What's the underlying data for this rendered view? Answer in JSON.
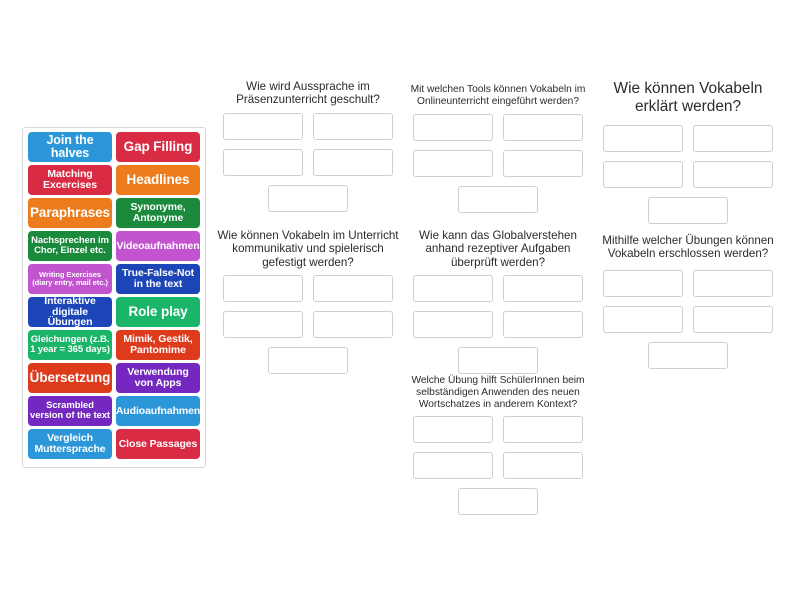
{
  "tile_bank": {
    "name": "answer-tiles",
    "tiles": [
      {
        "label": "Join the halves",
        "color": "#2b96d8",
        "size": "lg"
      },
      {
        "label": "Gap Filling",
        "color": "#d92b43",
        "size": "xl"
      },
      {
        "label": "Matching\nExcercises",
        "color": "#d92b43",
        "size": "md"
      },
      {
        "label": "Headlines",
        "color": "#ec7c1c",
        "size": "xl"
      },
      {
        "label": "Paraphrases",
        "color": "#ec7c1c",
        "size": "xl"
      },
      {
        "label": "Synonyme,\nAntonyme",
        "color": "#1c8a3c",
        "size": "md"
      },
      {
        "label": "Nachsprechen im\nChor, Einzel etc.",
        "color": "#1c8a3c",
        "size": "sm"
      },
      {
        "label": "Videoaufnahmen",
        "color": "#c254d0",
        "size": "md"
      },
      {
        "label": "Writing Exercises\n(diary entry, mail etc.)",
        "color": "#c254d0",
        "size": "xs"
      },
      {
        "label": "True-False-Not\nin the text",
        "color": "#1c46b8",
        "size": "md"
      },
      {
        "label": "Interaktive\ndigitale Übungen",
        "color": "#1c46b8",
        "size": "md"
      },
      {
        "label": "Role play",
        "color": "#1bb56a",
        "size": "xl"
      },
      {
        "label": "Gleichungen (z.B.\n1 year = 365 days)",
        "color": "#1bb56a",
        "size": "sm"
      },
      {
        "label": "Mimik, Gestik,\nPantomime",
        "color": "#dd3b1c",
        "size": "md"
      },
      {
        "label": "Übersetzung",
        "color": "#dd3b1c",
        "size": "xl"
      },
      {
        "label": "Verwendung\nvon Apps",
        "color": "#7428bf",
        "size": "md"
      },
      {
        "label": "Scrambled\nversion of the text",
        "color": "#7428bf",
        "size": "sm"
      },
      {
        "label": "Audioaufnahmen",
        "color": "#2b96d8",
        "size": "md"
      },
      {
        "label": "Vergleich\nMuttersprache",
        "color": "#2b96d8",
        "size": "md"
      },
      {
        "label": "Close Passages",
        "color": "#d92b43",
        "size": "md"
      }
    ]
  },
  "questions": [
    {
      "id": "q1",
      "title": "Wie wird Aussprache im Präsenzunterricht geschult?",
      "slot_count": 5
    },
    {
      "id": "q2",
      "title": "Mit welchen Tools können Vokabeln im Onlineunterricht eingeführt werden?",
      "slot_count": 5
    },
    {
      "id": "q3",
      "title": "Wie können Vokabeln erklärt werden?",
      "slot_count": 5
    },
    {
      "id": "q4",
      "title": "Wie können Vokabeln im Unterricht kommunikativ und spielerisch gefestigt werden?",
      "slot_count": 5
    },
    {
      "id": "q5",
      "title": "Wie kann das Globalverstehen anhand rezeptiver Aufgaben überprüft werden?",
      "slot_count": 5
    },
    {
      "id": "q6",
      "title": "Mithilfe welcher Übungen können Vokabeln erschlossen werden?",
      "slot_count": 5
    },
    {
      "id": "q7",
      "title": "Welche Übung hilft SchülerInnen beim selbständigen Anwenden des neuen Wortschatzes in anderem Kontext?",
      "slot_count": 5
    }
  ]
}
